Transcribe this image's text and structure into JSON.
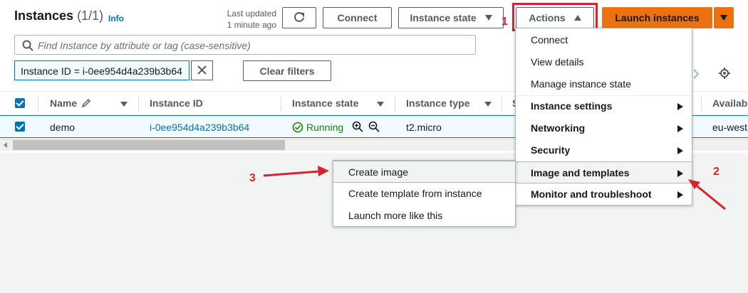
{
  "header": {
    "title": "Instances",
    "count": "(1/1)",
    "info_label": "Info",
    "last_updated_line1": "Last updated",
    "last_updated_line2": "1 minute ago",
    "connect_label": "Connect",
    "instance_state_label": "Instance state",
    "actions_label": "Actions",
    "launch_label": "Launch instances"
  },
  "search": {
    "placeholder": "Find Instance by attribute or tag (case-sensitive)",
    "filter_tag": "Instance ID = i-0ee954d4a239b3b64",
    "clear_filters_label": "Clear filters"
  },
  "table": {
    "columns": [
      "Name",
      "Instance ID",
      "Instance state",
      "Instance type",
      "S",
      "Availab"
    ],
    "rows": [
      {
        "name": "demo",
        "instance_id": "i-0ee954d4a239b3b64",
        "state": "Running",
        "type": "t2.micro",
        "availability": "eu-west"
      }
    ]
  },
  "actions_menu": {
    "items": [
      "Connect",
      "View details",
      "Manage instance state"
    ],
    "submenus": [
      "Instance settings",
      "Networking",
      "Security",
      "Image and templates",
      "Monitor and troubleshoot"
    ]
  },
  "image_submenu": {
    "items": [
      "Create image",
      "Create template from instance",
      "Launch more like this"
    ]
  },
  "annotations": {
    "step1": "1",
    "step2": "2",
    "step3": "3"
  },
  "colors": {
    "accent": "#0073bb",
    "primary_button": "#ec7211",
    "annotation": "#d6232e",
    "running": "#1d8102"
  }
}
